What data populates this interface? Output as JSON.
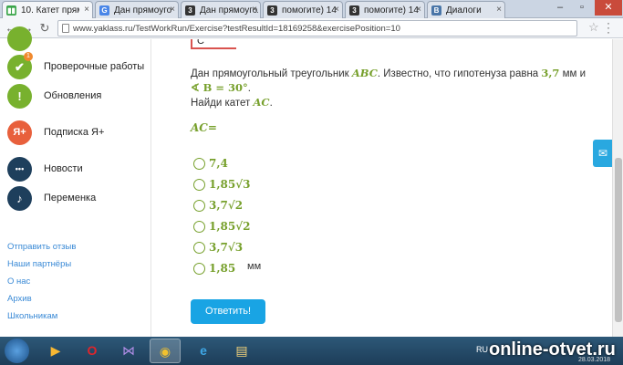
{
  "browser": {
    "tabs": [
      {
        "label": "10. Катет прям",
        "fav": "yaklass-icon",
        "color": "#3aa54a",
        "fav_text": "▮▮"
      },
      {
        "label": "Дан прямоуго",
        "fav": "google-icon",
        "color": "#4a86e8",
        "fav_text": "G"
      },
      {
        "label": "Дан прямоугол",
        "fav": "znanija-icon",
        "color": "#333333",
        "fav_text": "3"
      },
      {
        "label": "помогите) 14",
        "fav": "znanija-icon",
        "color": "#333333",
        "fav_text": "3"
      },
      {
        "label": "помогите) 14",
        "fav": "znanija-icon",
        "color": "#333333",
        "fav_text": "3"
      },
      {
        "label": "Диалоги",
        "fav": "vk-icon",
        "color": "#4a76a8",
        "fav_text": "В"
      }
    ],
    "url": "www.yaklass.ru/TestWorkRun/Exercise?testResultId=18169258&exercisePosition=10"
  },
  "sidebar": {
    "items": [
      {
        "label": "Проверочные работы",
        "icon": "check-icon",
        "color": "#78b12e",
        "glyph": "✔",
        "badge": "1"
      },
      {
        "label": "Обновления",
        "icon": "exclamation-icon",
        "color": "#78b12e",
        "glyph": "!"
      },
      {
        "label": "Подписка Я+",
        "icon": "ya-plus-icon",
        "color": "#e8603c",
        "glyph": "Я+"
      },
      {
        "label": "Новости",
        "icon": "chat-icon",
        "color": "#1e3f5c",
        "glyph": "•••"
      },
      {
        "label": "Переменка",
        "icon": "bell-icon",
        "color": "#1e3f5c",
        "glyph": "♪"
      }
    ],
    "links": [
      "Отправить отзыв",
      "Наши партнёры",
      "О нас",
      "Архив",
      "Школьникам"
    ]
  },
  "task": {
    "triangle_label": "C",
    "text_1": "Дан прямоугольный треугольник ",
    "abc": "ABC",
    "text_2": ". Известно, что гипотенуза равна ",
    "hyp": "3,7",
    "text_3": " мм и",
    "angle": "∢ B = 30°",
    "text_4": ".",
    "find": "Найди катет ",
    "ac": "AC",
    "find_end": ".",
    "answer_label": "AC="
  },
  "options": [
    {
      "text": "7,4"
    },
    {
      "text": "1,85√3"
    },
    {
      "text": "3,7√2"
    },
    {
      "text": "1,85√2"
    },
    {
      "text": "3,7√3"
    },
    {
      "text": "1,85"
    }
  ],
  "unit": "мм",
  "submit_label": "Ответить!",
  "taskbar": {
    "lang": "RU",
    "time": "20:55",
    "date": "28.03.2018"
  },
  "watermark": "online-otvet.ru"
}
